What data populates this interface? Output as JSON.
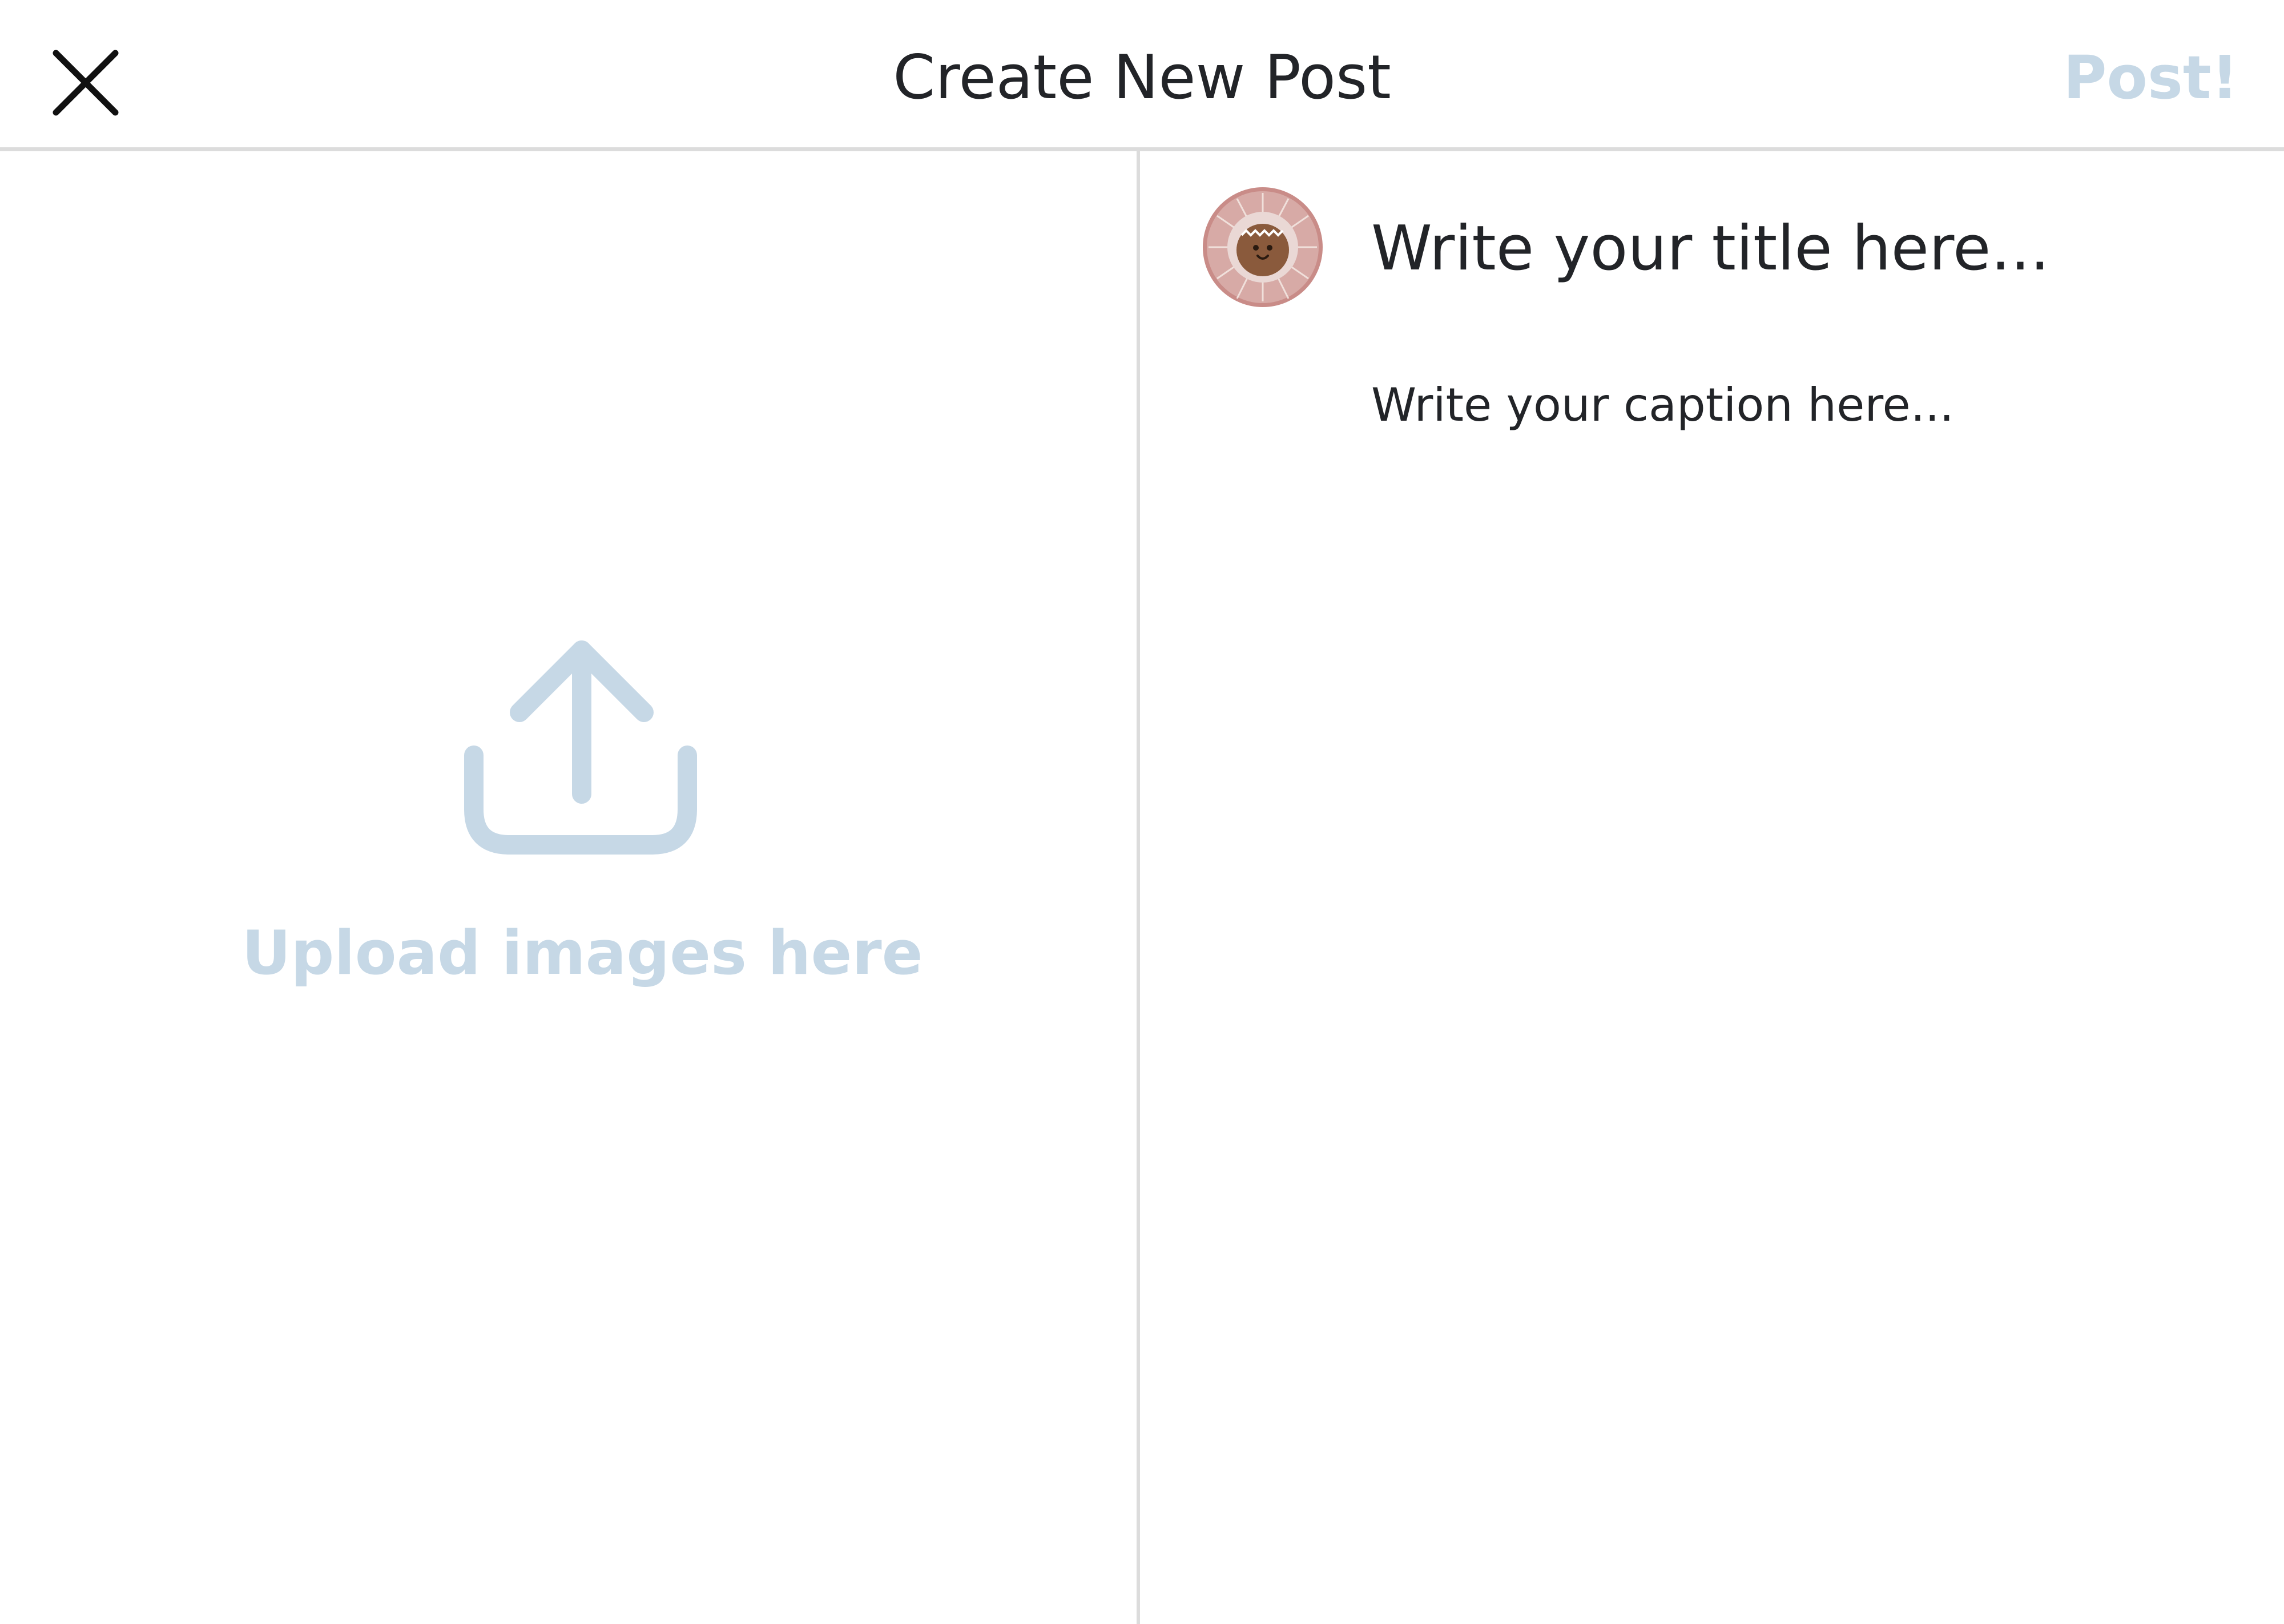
{
  "header": {
    "title": "Create New Post",
    "post_label": "Post!",
    "close_icon": "close-icon"
  },
  "upload": {
    "label": "Upload images here",
    "icon": "upload-icon"
  },
  "composer": {
    "title_placeholder": "Write your title here...",
    "caption_placeholder": "Write your caption here...",
    "title_value": "",
    "caption_value": ""
  },
  "colors": {
    "text": "#222428",
    "accent_muted": "#c6d8e6",
    "divider": "#dcdcdc"
  }
}
